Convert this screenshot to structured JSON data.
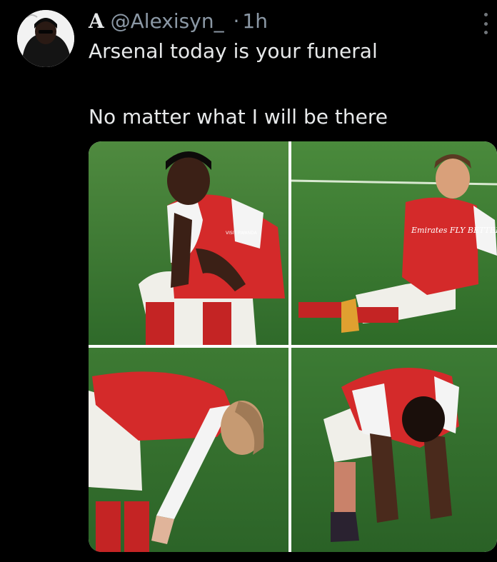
{
  "tweet": {
    "author": {
      "name": "A",
      "handle": "@Alexisyn_",
      "separator": "·",
      "time": "1h",
      "avatar_icon": "user-avatar-icon"
    },
    "text_lines": [
      "Arsenal today is your funeral",
      "No matter what I will be there"
    ],
    "more_icon": "more-vertical-icon",
    "media": {
      "panels": [
        {
          "name": "player-crouching",
          "shirt_text": "VISIT RWANDA"
        },
        {
          "name": "player-sitting",
          "shirt_text": "Emirates FLY BETTER"
        },
        {
          "name": "player-bending"
        },
        {
          "name": "player-hands-knees"
        }
      ]
    }
  },
  "colors": {
    "background": "#000000",
    "text": "#e7e9ea",
    "muted": "#8b98a5",
    "pitch": "#3f7a34",
    "shirt_red": "#d42a2a",
    "sleeve_white": "#f2f2f2"
  }
}
